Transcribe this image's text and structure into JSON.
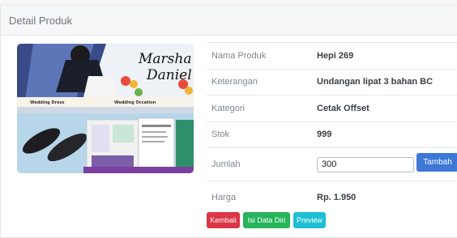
{
  "card": {
    "title": "Detail Produk"
  },
  "image": {
    "couple_names": [
      "Marsha",
      "Daniel"
    ],
    "caption_left": "Wedding Dress",
    "caption_right": "Wedding Occation"
  },
  "details": [
    {
      "label": "Nama Produk",
      "value": "Hepi 269"
    },
    {
      "label": "Keterangan",
      "value": "Undangan lipat 3 bahan BC"
    },
    {
      "label": "Kategori",
      "value": "Cetak Offset"
    },
    {
      "label": "Stok",
      "value": "999"
    }
  ],
  "jumlah": {
    "label": "Jumlah",
    "value": "300",
    "button": "Tambah"
  },
  "harga": {
    "label": "Harga",
    "value": "Rp. 1.950"
  },
  "actions": {
    "back": "Kembali",
    "fill": "Isi Data Diri",
    "preview": "Preview"
  },
  "colors": {
    "danger": "#dc3545",
    "success": "#27b45a",
    "info": "#1ebfd2",
    "primary": "#3d78d8"
  }
}
